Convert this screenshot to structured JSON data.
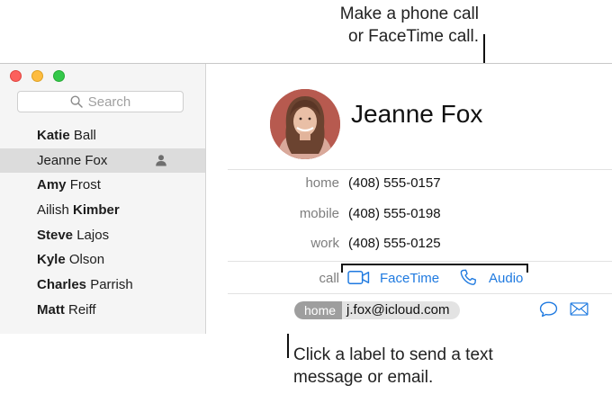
{
  "annotations": {
    "top": [
      "Make a phone call",
      "or FaceTime call."
    ],
    "bottom": [
      "Click a label to send a text",
      "message or email."
    ]
  },
  "sidebar": {
    "search_placeholder": "Search",
    "contacts": [
      {
        "first": "Katie",
        "last": "Ball",
        "bold_part": "first"
      },
      {
        "first": "Jeanne",
        "last": "Fox",
        "bold_part": "none"
      },
      {
        "first": "Amy",
        "last": "Frost",
        "bold_part": "first"
      },
      {
        "first": "Ailish",
        "last": "Kimber",
        "bold_part": "last"
      },
      {
        "first": "Steve",
        "last": "Lajos",
        "bold_part": "first"
      },
      {
        "first": "Kyle",
        "last": "Olson",
        "bold_part": "first"
      },
      {
        "first": "Charles",
        "last": "Parrish",
        "bold_part": "first"
      },
      {
        "first": "Matt",
        "last": "Reiff",
        "bold_part": "first"
      }
    ],
    "selected_index": 1
  },
  "detail": {
    "name": "Jeanne Fox",
    "phones": [
      {
        "label": "home",
        "number": "(408) 555-0157"
      },
      {
        "label": "mobile",
        "number": "(408) 555-0198"
      },
      {
        "label": "work",
        "number": "(408) 555-0125"
      }
    ],
    "call": {
      "label": "call",
      "facetime": "FaceTime",
      "audio": "Audio"
    },
    "email": {
      "label": "home",
      "address": "j.fox@icloud.com"
    }
  },
  "colors": {
    "accent": "#1f7ae0",
    "close": "#fc605c",
    "minimize": "#fdbc40",
    "maximize": "#34c84a"
  }
}
